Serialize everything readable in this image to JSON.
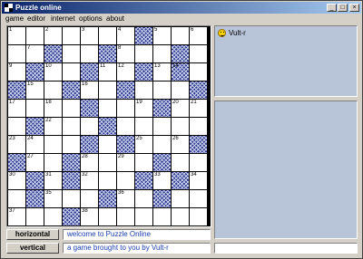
{
  "window": {
    "title": "Puzzle online"
  },
  "menu": {
    "items": [
      "game",
      "editor",
      "internet",
      "options",
      "about"
    ]
  },
  "board": {
    "size": 11,
    "blocks": [
      [
        0,
        7
      ],
      [
        1,
        2
      ],
      [
        1,
        5
      ],
      [
        1,
        9
      ],
      [
        2,
        1
      ],
      [
        2,
        4
      ],
      [
        2,
        7
      ],
      [
        2,
        9
      ],
      [
        3,
        0
      ],
      [
        3,
        3
      ],
      [
        3,
        6
      ],
      [
        3,
        10
      ],
      [
        4,
        4
      ],
      [
        4,
        8
      ],
      [
        5,
        1
      ],
      [
        5,
        5
      ],
      [
        6,
        4
      ],
      [
        6,
        6
      ],
      [
        6,
        10
      ],
      [
        7,
        0
      ],
      [
        7,
        3
      ],
      [
        7,
        8
      ],
      [
        8,
        1
      ],
      [
        8,
        3
      ],
      [
        8,
        7
      ],
      [
        8,
        9
      ],
      [
        9,
        1
      ],
      [
        9,
        5
      ],
      [
        9,
        8
      ],
      [
        10,
        3
      ]
    ],
    "numbers": [
      {
        "r": 0,
        "c": 0,
        "n": "1"
      },
      {
        "r": 0,
        "c": 2,
        "n": "2"
      },
      {
        "r": 0,
        "c": 4,
        "n": "3"
      },
      {
        "r": 0,
        "c": 6,
        "n": "4"
      },
      {
        "r": 0,
        "c": 8,
        "n": "5"
      },
      {
        "r": 0,
        "c": 10,
        "n": "6"
      },
      {
        "r": 1,
        "c": 1,
        "n": "7"
      },
      {
        "r": 1,
        "c": 6,
        "n": "8"
      },
      {
        "r": 2,
        "c": 0,
        "n": "9"
      },
      {
        "r": 2,
        "c": 2,
        "n": "10"
      },
      {
        "r": 2,
        "c": 5,
        "n": "11"
      },
      {
        "r": 2,
        "c": 6,
        "n": "12"
      },
      {
        "r": 2,
        "c": 8,
        "n": "13"
      },
      {
        "r": 2,
        "c": 9,
        "n": "14"
      },
      {
        "r": 3,
        "c": 1,
        "n": "15"
      },
      {
        "r": 3,
        "c": 4,
        "n": "16"
      },
      {
        "r": 4,
        "c": 0,
        "n": "17"
      },
      {
        "r": 4,
        "c": 2,
        "n": "18"
      },
      {
        "r": 4,
        "c": 7,
        "n": "19"
      },
      {
        "r": 4,
        "c": 9,
        "n": "20"
      },
      {
        "r": 4,
        "c": 10,
        "n": "21"
      },
      {
        "r": 5,
        "c": 2,
        "n": "22"
      },
      {
        "r": 6,
        "c": 0,
        "n": "23"
      },
      {
        "r": 6,
        "c": 1,
        "n": "24"
      },
      {
        "r": 6,
        "c": 7,
        "n": "25"
      },
      {
        "r": 6,
        "c": 9,
        "n": "26"
      },
      {
        "r": 7,
        "c": 1,
        "n": "27"
      },
      {
        "r": 7,
        "c": 4,
        "n": "28"
      },
      {
        "r": 7,
        "c": 6,
        "n": "29"
      },
      {
        "r": 8,
        "c": 0,
        "n": "30"
      },
      {
        "r": 8,
        "c": 2,
        "n": "31"
      },
      {
        "r": 8,
        "c": 4,
        "n": "32"
      },
      {
        "r": 8,
        "c": 8,
        "n": "33"
      },
      {
        "r": 8,
        "c": 10,
        "n": "34"
      },
      {
        "r": 9,
        "c": 2,
        "n": "35"
      },
      {
        "r": 9,
        "c": 6,
        "n": "36"
      },
      {
        "r": 10,
        "c": 0,
        "n": "37"
      },
      {
        "r": 10,
        "c": 4,
        "n": "38"
      }
    ]
  },
  "clues": {
    "horizontal_label": "horizontal",
    "horizontal_text": "welcome to Puzzle Online",
    "vertical_label": "vertical",
    "vertical_text": "a game brought to you by Vult-r"
  },
  "users": [
    {
      "name": "Vult-r",
      "icon": "smiley-icon"
    }
  ],
  "colors": {
    "title_start": "#0a246a",
    "title_end": "#a6caf0",
    "block": "#2d3a8c",
    "panel": "#b8c4d8",
    "clue_text": "#1a3db0"
  }
}
